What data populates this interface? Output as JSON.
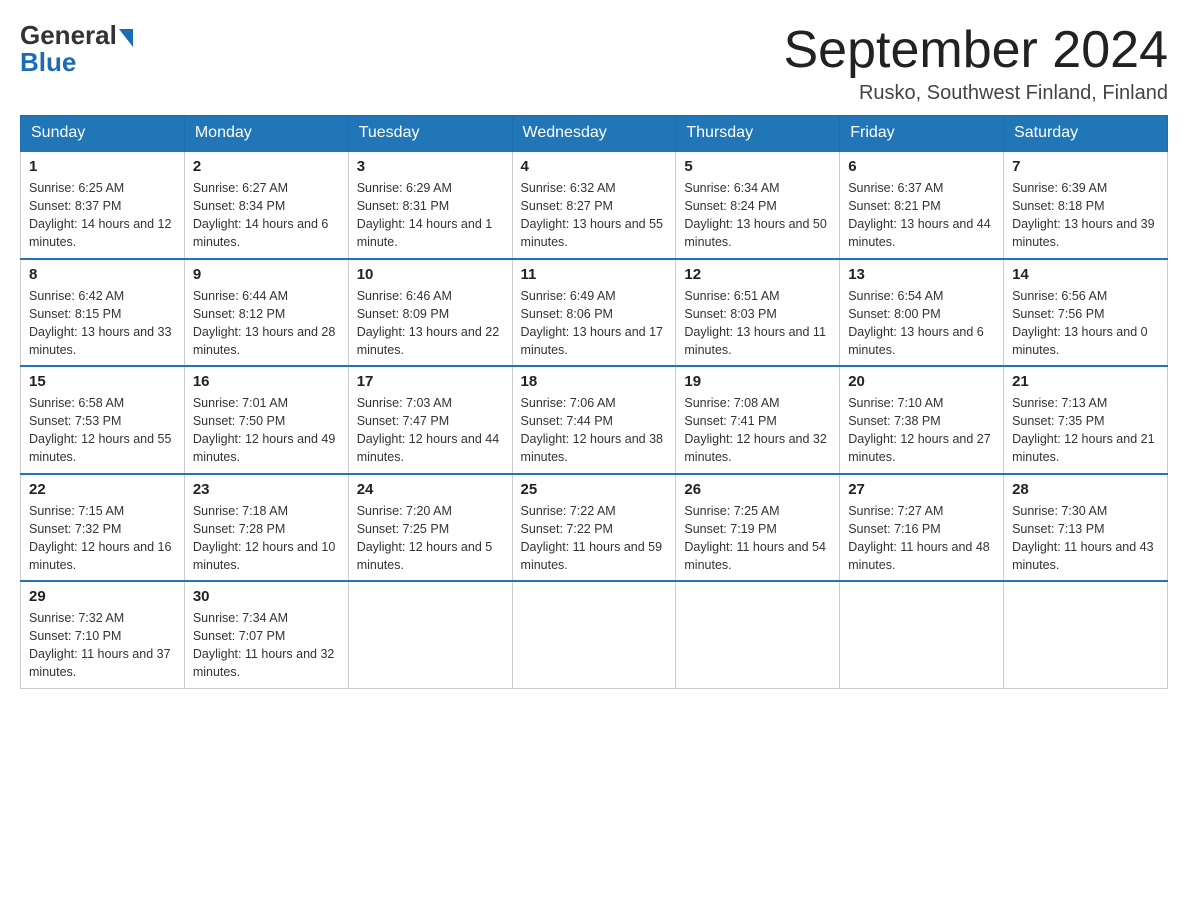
{
  "header": {
    "logo_general": "General",
    "logo_blue": "Blue",
    "month_title": "September 2024",
    "location": "Rusko, Southwest Finland, Finland"
  },
  "weekdays": [
    "Sunday",
    "Monday",
    "Tuesday",
    "Wednesday",
    "Thursday",
    "Friday",
    "Saturday"
  ],
  "weeks": [
    [
      {
        "day": "1",
        "sunrise": "Sunrise: 6:25 AM",
        "sunset": "Sunset: 8:37 PM",
        "daylight": "Daylight: 14 hours and 12 minutes."
      },
      {
        "day": "2",
        "sunrise": "Sunrise: 6:27 AM",
        "sunset": "Sunset: 8:34 PM",
        "daylight": "Daylight: 14 hours and 6 minutes."
      },
      {
        "day": "3",
        "sunrise": "Sunrise: 6:29 AM",
        "sunset": "Sunset: 8:31 PM",
        "daylight": "Daylight: 14 hours and 1 minute."
      },
      {
        "day": "4",
        "sunrise": "Sunrise: 6:32 AM",
        "sunset": "Sunset: 8:27 PM",
        "daylight": "Daylight: 13 hours and 55 minutes."
      },
      {
        "day": "5",
        "sunrise": "Sunrise: 6:34 AM",
        "sunset": "Sunset: 8:24 PM",
        "daylight": "Daylight: 13 hours and 50 minutes."
      },
      {
        "day": "6",
        "sunrise": "Sunrise: 6:37 AM",
        "sunset": "Sunset: 8:21 PM",
        "daylight": "Daylight: 13 hours and 44 minutes."
      },
      {
        "day": "7",
        "sunrise": "Sunrise: 6:39 AM",
        "sunset": "Sunset: 8:18 PM",
        "daylight": "Daylight: 13 hours and 39 minutes."
      }
    ],
    [
      {
        "day": "8",
        "sunrise": "Sunrise: 6:42 AM",
        "sunset": "Sunset: 8:15 PM",
        "daylight": "Daylight: 13 hours and 33 minutes."
      },
      {
        "day": "9",
        "sunrise": "Sunrise: 6:44 AM",
        "sunset": "Sunset: 8:12 PM",
        "daylight": "Daylight: 13 hours and 28 minutes."
      },
      {
        "day": "10",
        "sunrise": "Sunrise: 6:46 AM",
        "sunset": "Sunset: 8:09 PM",
        "daylight": "Daylight: 13 hours and 22 minutes."
      },
      {
        "day": "11",
        "sunrise": "Sunrise: 6:49 AM",
        "sunset": "Sunset: 8:06 PM",
        "daylight": "Daylight: 13 hours and 17 minutes."
      },
      {
        "day": "12",
        "sunrise": "Sunrise: 6:51 AM",
        "sunset": "Sunset: 8:03 PM",
        "daylight": "Daylight: 13 hours and 11 minutes."
      },
      {
        "day": "13",
        "sunrise": "Sunrise: 6:54 AM",
        "sunset": "Sunset: 8:00 PM",
        "daylight": "Daylight: 13 hours and 6 minutes."
      },
      {
        "day": "14",
        "sunrise": "Sunrise: 6:56 AM",
        "sunset": "Sunset: 7:56 PM",
        "daylight": "Daylight: 13 hours and 0 minutes."
      }
    ],
    [
      {
        "day": "15",
        "sunrise": "Sunrise: 6:58 AM",
        "sunset": "Sunset: 7:53 PM",
        "daylight": "Daylight: 12 hours and 55 minutes."
      },
      {
        "day": "16",
        "sunrise": "Sunrise: 7:01 AM",
        "sunset": "Sunset: 7:50 PM",
        "daylight": "Daylight: 12 hours and 49 minutes."
      },
      {
        "day": "17",
        "sunrise": "Sunrise: 7:03 AM",
        "sunset": "Sunset: 7:47 PM",
        "daylight": "Daylight: 12 hours and 44 minutes."
      },
      {
        "day": "18",
        "sunrise": "Sunrise: 7:06 AM",
        "sunset": "Sunset: 7:44 PM",
        "daylight": "Daylight: 12 hours and 38 minutes."
      },
      {
        "day": "19",
        "sunrise": "Sunrise: 7:08 AM",
        "sunset": "Sunset: 7:41 PM",
        "daylight": "Daylight: 12 hours and 32 minutes."
      },
      {
        "day": "20",
        "sunrise": "Sunrise: 7:10 AM",
        "sunset": "Sunset: 7:38 PM",
        "daylight": "Daylight: 12 hours and 27 minutes."
      },
      {
        "day": "21",
        "sunrise": "Sunrise: 7:13 AM",
        "sunset": "Sunset: 7:35 PM",
        "daylight": "Daylight: 12 hours and 21 minutes."
      }
    ],
    [
      {
        "day": "22",
        "sunrise": "Sunrise: 7:15 AM",
        "sunset": "Sunset: 7:32 PM",
        "daylight": "Daylight: 12 hours and 16 minutes."
      },
      {
        "day": "23",
        "sunrise": "Sunrise: 7:18 AM",
        "sunset": "Sunset: 7:28 PM",
        "daylight": "Daylight: 12 hours and 10 minutes."
      },
      {
        "day": "24",
        "sunrise": "Sunrise: 7:20 AM",
        "sunset": "Sunset: 7:25 PM",
        "daylight": "Daylight: 12 hours and 5 minutes."
      },
      {
        "day": "25",
        "sunrise": "Sunrise: 7:22 AM",
        "sunset": "Sunset: 7:22 PM",
        "daylight": "Daylight: 11 hours and 59 minutes."
      },
      {
        "day": "26",
        "sunrise": "Sunrise: 7:25 AM",
        "sunset": "Sunset: 7:19 PM",
        "daylight": "Daylight: 11 hours and 54 minutes."
      },
      {
        "day": "27",
        "sunrise": "Sunrise: 7:27 AM",
        "sunset": "Sunset: 7:16 PM",
        "daylight": "Daylight: 11 hours and 48 minutes."
      },
      {
        "day": "28",
        "sunrise": "Sunrise: 7:30 AM",
        "sunset": "Sunset: 7:13 PM",
        "daylight": "Daylight: 11 hours and 43 minutes."
      }
    ],
    [
      {
        "day": "29",
        "sunrise": "Sunrise: 7:32 AM",
        "sunset": "Sunset: 7:10 PM",
        "daylight": "Daylight: 11 hours and 37 minutes."
      },
      {
        "day": "30",
        "sunrise": "Sunrise: 7:34 AM",
        "sunset": "Sunset: 7:07 PM",
        "daylight": "Daylight: 11 hours and 32 minutes."
      },
      null,
      null,
      null,
      null,
      null
    ]
  ]
}
